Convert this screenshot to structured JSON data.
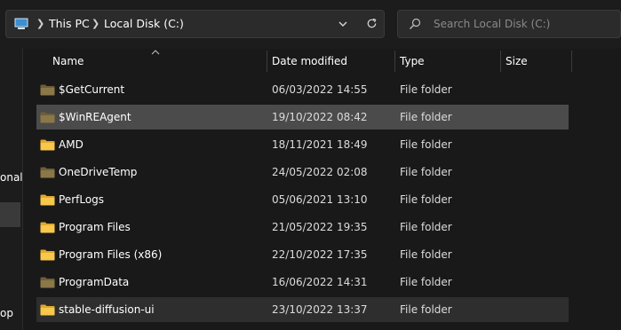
{
  "address_bar": {
    "crumbs": [
      "This PC",
      "Local Disk (C:)"
    ]
  },
  "search": {
    "placeholder": "Search Local Disk (C:)"
  },
  "nav": {
    "partial_1": "onal",
    "partial_2": "op"
  },
  "columns": {
    "name": "Name",
    "date": "Date modified",
    "type": "Type",
    "size": "Size"
  },
  "files": [
    {
      "name": "$GetCurrent",
      "date": "06/03/2022 14:55",
      "type": "File folder",
      "hidden": true
    },
    {
      "name": "$WinREAgent",
      "date": "19/10/2022 08:42",
      "type": "File folder",
      "hidden": true,
      "state": "selected"
    },
    {
      "name": "AMD",
      "date": "18/11/2021 18:49",
      "type": "File folder",
      "hidden": false
    },
    {
      "name": "OneDriveTemp",
      "date": "24/05/2022 02:08",
      "type": "File folder",
      "hidden": true
    },
    {
      "name": "PerfLogs",
      "date": "05/06/2021 13:10",
      "type": "File folder",
      "hidden": false
    },
    {
      "name": "Program Files",
      "date": "21/05/2022 19:35",
      "type": "File folder",
      "hidden": false
    },
    {
      "name": "Program Files (x86)",
      "date": "22/10/2022 17:35",
      "type": "File folder",
      "hidden": false
    },
    {
      "name": "ProgramData",
      "date": "16/06/2022 14:31",
      "type": "File folder",
      "hidden": true
    },
    {
      "name": "stable-diffusion-ui",
      "date": "23/10/2022 13:37",
      "type": "File folder",
      "hidden": false,
      "state": "hover"
    }
  ],
  "colors": {
    "folder": "#f8c74b",
    "folder_hidden": "#8b7748",
    "selected_row": "#4b4b4b",
    "hover_row": "#2e2e2e"
  },
  "icons": {
    "pc": "this-pc-icon",
    "chevron_right": "chevron-right-icon",
    "dropdown": "chevron-down-icon",
    "refresh": "refresh-icon",
    "search": "search-icon",
    "folder": "folder-icon"
  }
}
